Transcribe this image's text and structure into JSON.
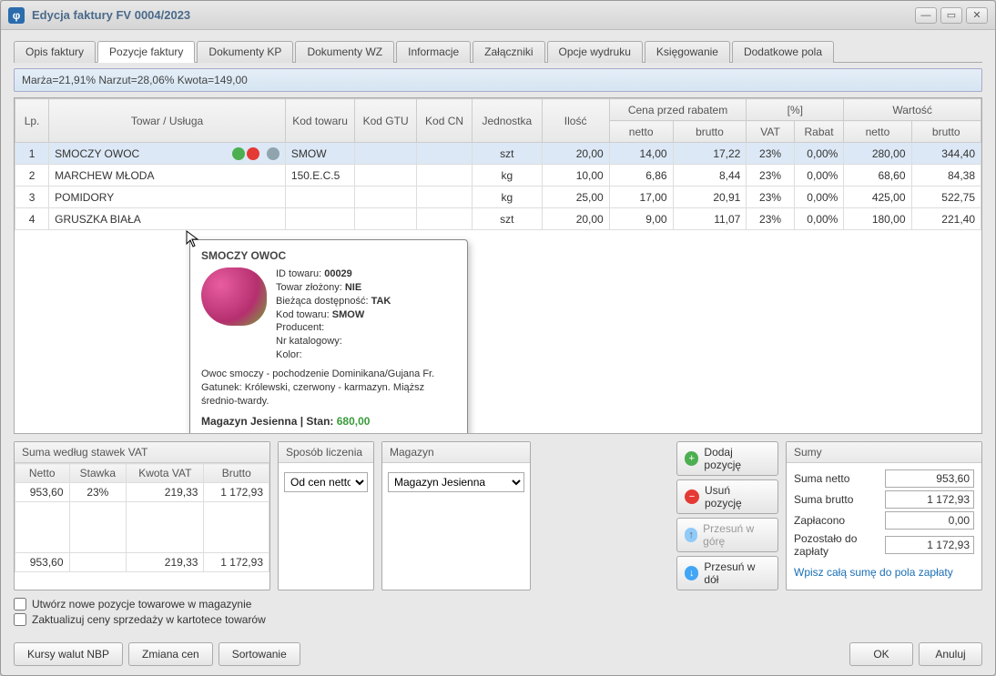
{
  "titlebar": {
    "title": "Edycja faktury FV 0004/2023",
    "app_glyph": "φ"
  },
  "tabs": {
    "items": [
      "Opis faktury",
      "Pozycje faktury",
      "Dokumenty KP",
      "Dokumenty WZ",
      "Informacje",
      "Załączniki",
      "Opcje wydruku",
      "Księgowanie",
      "Dodatkowe pola"
    ],
    "active_index": 1
  },
  "info_strip": "Marża=21,91%  Narzut=28,06%  Kwota=149,00",
  "grid": {
    "group_headers": {
      "price_before": "Cena przed rabatem",
      "percent": "[%]",
      "value": "Wartość"
    },
    "headers": {
      "lp": "Lp.",
      "name": "Towar / Usługa",
      "code": "Kod towaru",
      "gtu": "Kod GTU",
      "cn": "Kod CN",
      "unit": "Jednostka",
      "qty": "Ilość",
      "netto": "netto",
      "brutto": "brutto",
      "vat": "VAT",
      "rabat": "Rabat",
      "wnetto": "netto",
      "wbrutto": "brutto"
    },
    "rows": [
      {
        "lp": "1",
        "name": "SMOCZY OWOC",
        "code": "SMOW",
        "unit": "szt",
        "qty": "20,00",
        "netto": "14,00",
        "brutto": "17,22",
        "vat": "23%",
        "rabat": "0,00%",
        "wnetto": "280,00",
        "wbrutto": "344,40",
        "selected": true,
        "has_icons": true
      },
      {
        "lp": "2",
        "name": "MARCHEW MŁODA",
        "code": "150.E.C.5",
        "unit": "kg",
        "qty": "10,00",
        "netto": "6,86",
        "brutto": "8,44",
        "vat": "23%",
        "rabat": "0,00%",
        "wnetto": "68,60",
        "wbrutto": "84,38"
      },
      {
        "lp": "3",
        "name": "POMIDORY",
        "code": "",
        "unit": "kg",
        "qty": "25,00",
        "netto": "17,00",
        "brutto": "20,91",
        "vat": "23%",
        "rabat": "0,00%",
        "wnetto": "425,00",
        "wbrutto": "522,75"
      },
      {
        "lp": "4",
        "name": "GRUSZKA BIAŁA",
        "code": "",
        "unit": "szt",
        "qty": "20,00",
        "netto": "9,00",
        "brutto": "11,07",
        "vat": "23%",
        "rabat": "0,00%",
        "wnetto": "180,00",
        "wbrutto": "221,40"
      }
    ]
  },
  "tooltip": {
    "title": "SMOCZY OWOC",
    "id_label": "ID towaru:",
    "id_value": "00029",
    "complex_label": "Towar złożony:",
    "complex_value": "NIE",
    "avail_label": "Bieżąca dostępność:",
    "avail_value": "TAK",
    "code_label": "Kod towaru:",
    "code_value": "SMOW",
    "producer_label": "Producent:",
    "catalog_label": "Nr katalogowy:",
    "color_label": "Kolor:",
    "desc": "Owoc smoczy - pochodzenie Dominikana/Gujana Fr. Gatunek: Królewski, czerwony - karmazyn. Miąższ średnio-twardy.",
    "stock_label": "Magazyn Jesienna | Stan:",
    "stock_value": "680,00"
  },
  "vat_panel": {
    "title": "Suma według stawek VAT",
    "headers": {
      "netto": "Netto",
      "rate": "Stawka",
      "kwota": "Kwota VAT",
      "brutto": "Brutto"
    },
    "row": {
      "netto": "953,60",
      "rate": "23%",
      "kwota": "219,33",
      "brutto": "1 172,93"
    },
    "footer": {
      "netto": "953,60",
      "kwota": "219,33",
      "brutto": "1 172,93"
    }
  },
  "calc_mode": {
    "title": "Sposób liczenia",
    "selected": "Od cen netto"
  },
  "warehouse": {
    "title": "Magazyn",
    "selected": "Magazyn Jesienna"
  },
  "actions": {
    "add": "Dodaj pozycję",
    "remove": "Usuń pozycję",
    "up": "Przesuń w górę",
    "down": "Przesuń w dół"
  },
  "sums": {
    "title": "Sumy",
    "rows": [
      {
        "label": "Suma netto",
        "value": "953,60"
      },
      {
        "label": "Suma brutto",
        "value": "1 172,93"
      },
      {
        "label": "Zapłacono",
        "value": "0,00"
      },
      {
        "label": "Pozostało do zapłaty",
        "value": "1 172,93"
      }
    ],
    "link": "Wpisz całą sumę do pola zapłaty"
  },
  "checks": {
    "create": "Utwórz nowe pozycje towarowe w magazynie",
    "update": "Zaktualizuj ceny sprzedaży w kartotece towarów"
  },
  "bottom": {
    "rates": "Kursy walut NBP",
    "prices": "Zmiana cen",
    "sort": "Sortowanie",
    "ok": "OK",
    "cancel": "Anuluj"
  }
}
